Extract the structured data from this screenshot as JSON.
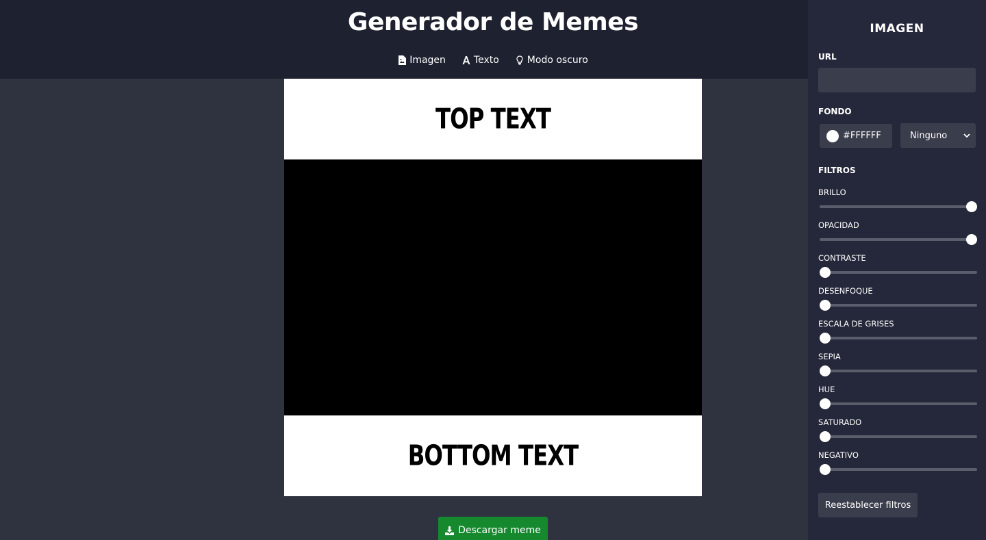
{
  "header": {
    "title": "Generador de Memes",
    "nav": [
      {
        "label": "Imagen",
        "icon": "file-image-icon"
      },
      {
        "label": "Texto",
        "icon": "font-icon"
      },
      {
        "label": "Modo oscuro",
        "icon": "lightbulb-icon"
      }
    ]
  },
  "meme": {
    "top_text": "TOP TEXT",
    "bottom_text": "BOTTOM TEXT",
    "image_background": "#000000"
  },
  "download_button": {
    "label": "Descargar meme",
    "icon": "download-icon",
    "color": "#16892f"
  },
  "panel": {
    "title": "IMAGEN",
    "url": {
      "label": "URL",
      "value": ""
    },
    "background": {
      "label": "FONDO",
      "color_value": "#FFFFFF",
      "blend_mode": "Ninguno"
    },
    "filters": {
      "label": "FILTROS",
      "items": [
        {
          "label": "BRILLO",
          "level": 1.0
        },
        {
          "label": "OPACIDAD",
          "level": 1.0
        },
        {
          "label": "CONTRASTE",
          "level": 0.0
        },
        {
          "label": "DESENFOQUE",
          "level": 0.0
        },
        {
          "label": "ESCALA DE GRISES",
          "level": 0.0
        },
        {
          "label": "SEPIA",
          "level": 0.0
        },
        {
          "label": "HUE",
          "level": 0.0
        },
        {
          "label": "SATURADO",
          "level": 0.0
        },
        {
          "label": "NEGATIVO",
          "level": 0.0
        }
      ]
    },
    "reset_button": "Reestablecer filtros"
  }
}
